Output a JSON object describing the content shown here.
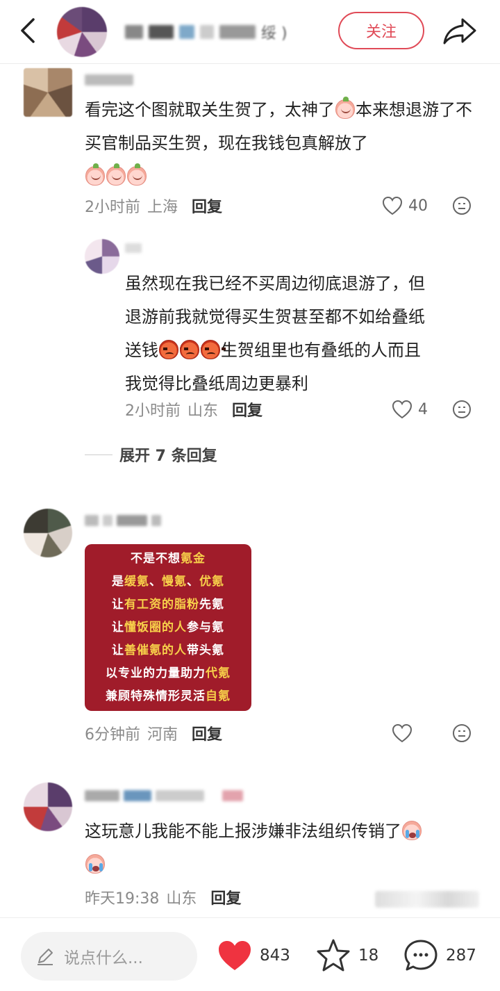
{
  "header": {
    "name_suffix": "绥 )",
    "follow_label": "关注"
  },
  "comments": [
    {
      "text": "看完这个图就取关生贺了，太神了",
      "text2": "本来想退游了不买官制品买生贺，现在我钱包真解放了",
      "time": "2小时前",
      "location": "上海",
      "reply_label": "回复",
      "likes": "40"
    },
    {
      "text_line1": "虽然现在我已经不买周边彻底退游了，但",
      "text_line2": "退游前我就觉得买生贺甚至都不如给叠纸",
      "text_line3a": "送钱",
      "text_line3b": "生贺组里也有叠纸的人而且",
      "text_line4": "我觉得比叠纸周边更暴利",
      "time": "2小时前",
      "location": "山东",
      "reply_label": "回复",
      "likes": "4"
    },
    {
      "time": "6分钟前",
      "location": "河南",
      "reply_label": "回复",
      "sticker": {
        "l1a": "不是不想",
        "l1b": "氪金",
        "l2a": "是",
        "l2b": "缓氪",
        "l2c": "、",
        "l2d": "慢氪",
        "l2e": "、",
        "l2f": "优氪",
        "l3a": "让",
        "l3b": "有工资的脂粉",
        "l3c": "先氪",
        "l4a": "让",
        "l4b": "懂饭圈的人",
        "l4c": "参与氪",
        "l5a": "让",
        "l5b": "善催氪的人",
        "l5c": "带头氪",
        "l6a": "以专业的力量助力",
        "l6b": "代氪",
        "l7a": "兼顾特殊情形灵活",
        "l7b": "自氪"
      }
    },
    {
      "text": "这玩意儿我能不能上报涉嫌非法组织传销了",
      "time": "昨天19:38",
      "location": "山东",
      "reply_label": "回复"
    }
  ],
  "expand_label": "展开 7 条回复",
  "bottom_bar": {
    "input_placeholder": "说点什么...",
    "likes": "843",
    "favorites": "18",
    "comments": "287"
  },
  "colors": {
    "accent": "#e04a57",
    "like_red": "#ef3340",
    "sticker_bg": "#a01c2a",
    "sticker_highlight": "#f7cf4a"
  }
}
